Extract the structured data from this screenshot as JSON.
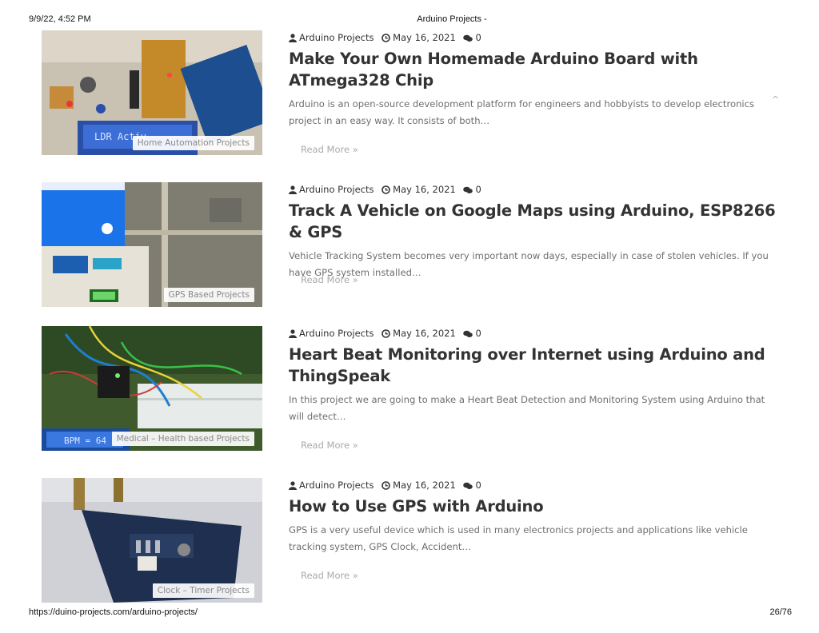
{
  "header": {
    "datetime": "9/9/22, 4:52 PM",
    "page_title": "Arduino Projects -"
  },
  "footer": {
    "url": "https://duino-projects.com/arduino-projects/",
    "page_count": "26/76"
  },
  "posts": [
    {
      "author": "Arduino Projects",
      "date": "May 16, 2021",
      "comments": "0",
      "title": "Make Your Own Homemade Arduino Board with ATmega328 Chip",
      "excerpt": "Arduino is an open-source development platform for engineers and hobbyists to develop electronics project in an easy way. It consists of both…",
      "read_more": "Read More »",
      "category": "Home Automation Projects",
      "image_text": "LDR Activ"
    },
    {
      "author": "Arduino Projects",
      "date": "May 16, 2021",
      "comments": "0",
      "title": "Track A Vehicle on Google Maps using Arduino, ESP8266 & GPS",
      "excerpt": "Vehicle Tracking System becomes very important now days, especially in case of stolen vehicles. If you have GPS system installed…",
      "read_more": "Read More »",
      "category": "GPS Based Projects"
    },
    {
      "author": "Arduino Projects",
      "date": "May 16, 2021",
      "comments": "0",
      "title": "Heart Beat Monitoring over Internet using Arduino and ThingSpeak",
      "excerpt": "In this project we are going to make a Heart Beat Detection and Monitoring System using Arduino that will detect…",
      "read_more": "Read More »",
      "category": "Medical – Health based Projects",
      "image_text": "BPM = 64"
    },
    {
      "author": "Arduino Projects",
      "date": "May 16, 2021",
      "comments": "0",
      "title": "How to Use GPS with Arduino",
      "excerpt": "GPS is a very useful device which is used in many electronics projects and applications like vehicle tracking system, GPS Clock, Accident…",
      "read_more": "Read More »",
      "category": "Clock – Timer Projects"
    }
  ],
  "icons": {
    "author": "user-icon",
    "date": "clock-icon",
    "comments": "comments-icon",
    "scroll": "chevron-up-icon"
  }
}
